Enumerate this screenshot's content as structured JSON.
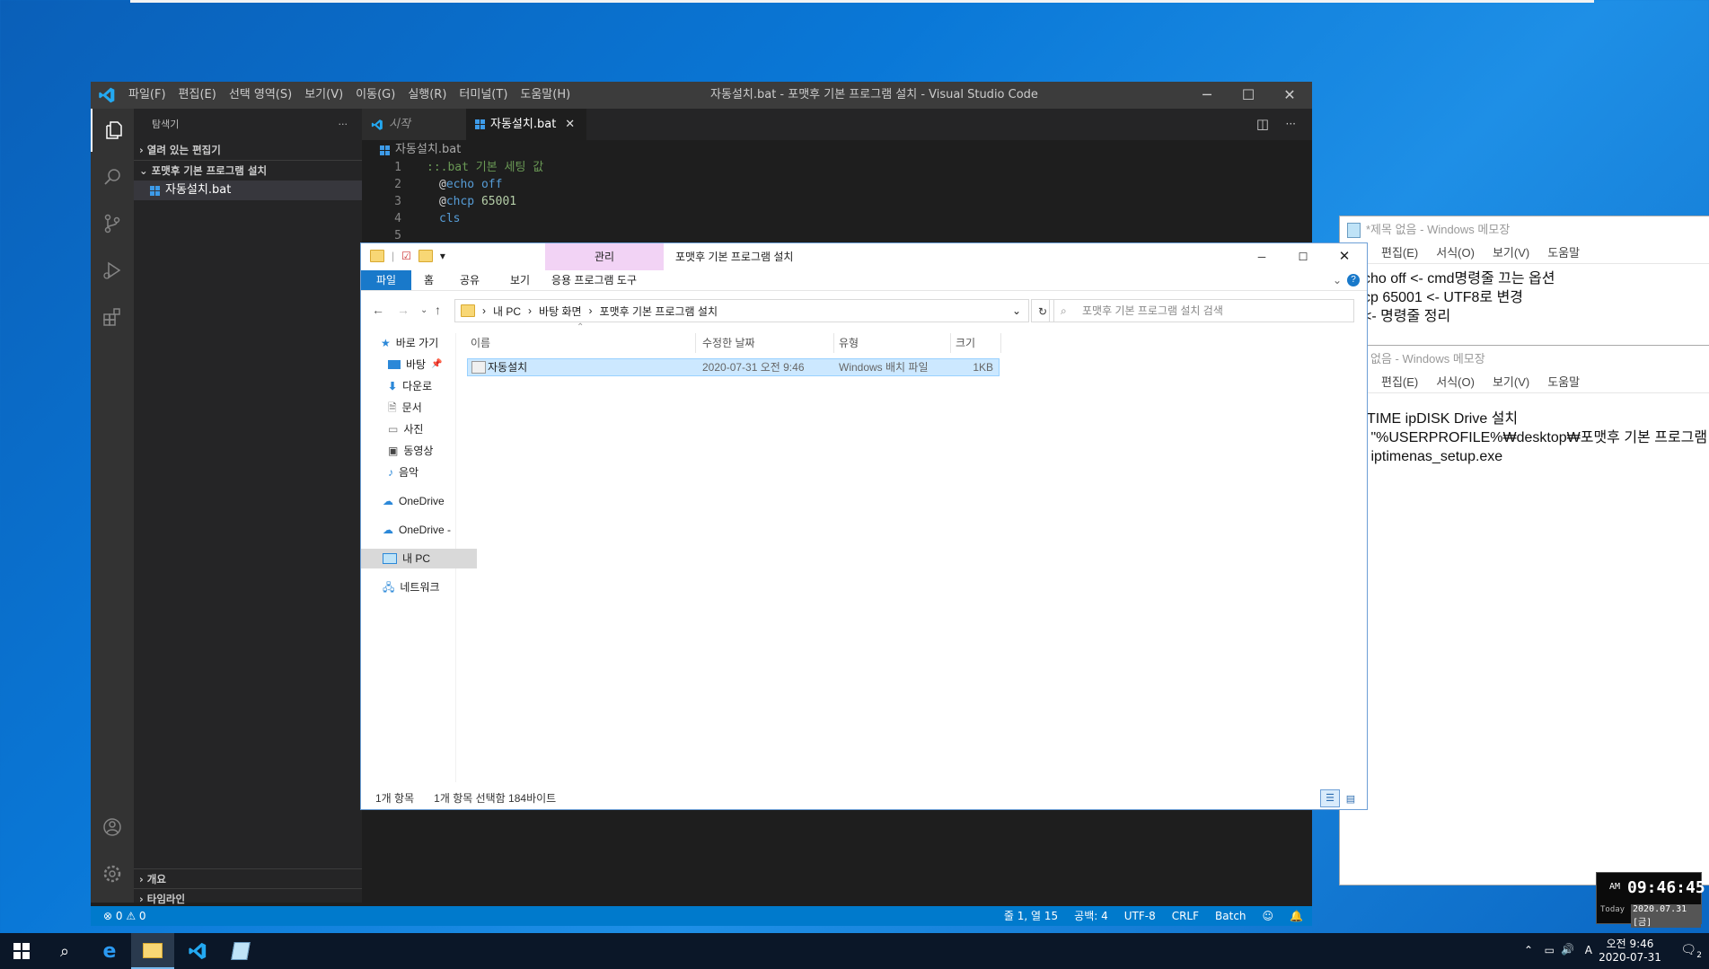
{
  "notepad1": {
    "title": "*제목 없음 - Windows 메모장",
    "menu": [
      "편집(E)",
      "서식(O)",
      "보기(V)",
      "도움말"
    ],
    "lines": [
      "cho off <- cmd명령줄 끄는 옵션",
      "cp 65001 <- UTF8로 변경",
      "<- 명령줄 정리"
    ]
  },
  "notepad2": {
    "title": "없음 - Windows 메모장",
    "menu": [
      "편집(E)",
      "서식(O)",
      "보기(V)",
      "도움말"
    ],
    "lines": [
      "TIME ipDISK Drive 설치",
      " \"%USERPROFILE%₩desktop₩포맷후 기본 프로그램",
      " iptimenas_setup.exe"
    ]
  },
  "vscode": {
    "menu": [
      "파일(F)",
      "편집(E)",
      "선택 영역(S)",
      "보기(V)",
      "이동(G)",
      "실행(R)",
      "터미널(T)",
      "도움말(H)"
    ],
    "window_title": "자동설치.bat - 포맷후 기본 프로그램 설치 - Visual Studio Code",
    "explorer_label": "탐색기",
    "open_editors": "열려 있는 편집기",
    "folder": "포맷후 기본 프로그램 설치",
    "file": "자동설치.bat",
    "outline": "개요",
    "timeline": "타임라인",
    "tabs": {
      "start": "시작",
      "active": "자동설치.bat"
    },
    "breadcrumb": "자동설치.bat",
    "code": {
      "l1": "::.bat 기본 세팅 값",
      "l2_kw": "echo",
      "l2_val": "off",
      "l3_kw": "chcp",
      "l3_val": "65001",
      "l4": "cls"
    },
    "line_numbers": [
      "1",
      "2",
      "3",
      "4",
      "5"
    ],
    "status": {
      "problems": "0",
      "warnings": "0",
      "position": "줄 1, 열 15",
      "spaces": "공백: 4",
      "encoding": "UTF-8",
      "eol": "CRLF",
      "language": "Batch"
    }
  },
  "explorer": {
    "title": "포맷후 기본 프로그램 설치",
    "manage_tab": "관리",
    "ribbon_tabs": [
      "파일",
      "홈",
      "공유",
      "보기"
    ],
    "app_tools": "응용 프로그램 도구",
    "address": [
      "내 PC",
      "바탕 화면",
      "포맷후 기본 프로그램 설치"
    ],
    "search_placeholder": "포맷후 기본 프로그램 설치 검색",
    "nav": {
      "quick": "바로 가기",
      "desktop": "바탕 ",
      "downloads": "다운로",
      "documents": "문서",
      "pictures": "사진",
      "videos": "동영상",
      "music": "음악",
      "onedrive1": "OneDrive",
      "onedrive2": "OneDrive -",
      "thispc": "내 PC",
      "network": "네트워크"
    },
    "columns": {
      "name": "이름",
      "modified": "수정한 날짜",
      "type": "유형",
      "size": "크기"
    },
    "file": {
      "name": "자동설치",
      "modified": "2020-07-31 오전 9:46",
      "type": "Windows 배치 파일",
      "size": "1KB"
    },
    "status_count": "1개 항목",
    "status_selected": "1개 항목 선택함 184바이트"
  },
  "clock": {
    "ampm": "AM",
    "time": "09:46:45",
    "today_label": "Today",
    "date": "2020.07.31 [금]"
  },
  "taskbar": {
    "time": "오전 9:46",
    "date": "2020-07-31",
    "ime": "A",
    "notifications": "2"
  }
}
